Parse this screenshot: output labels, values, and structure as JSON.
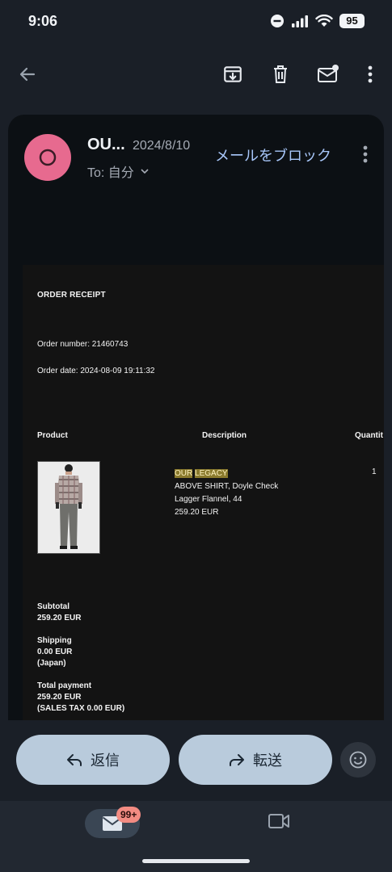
{
  "status_bar": {
    "time": "9:06",
    "battery": "95"
  },
  "toolbar": {
    "back_icon": "arrow-left-icon",
    "archive_icon": "archive-icon",
    "delete_icon": "trash-icon",
    "unread_icon": "mark-unread-icon",
    "more_icon": "more-vert-icon"
  },
  "email": {
    "avatar_letter": "O",
    "avatar_color": "#e76a8f",
    "sender": "OU...",
    "date": "2024/8/10",
    "to": "To: 自分",
    "block_link": "メールをブロック"
  },
  "receipt": {
    "title": "ORDER RECEIPT",
    "order_number": "Order number: 21460743",
    "order_date": "Order date: 2024-08-09 19:11:32",
    "headers": {
      "product": "Product",
      "description": "Description",
      "quantity": "Quantit"
    },
    "item": {
      "brand_1": "OUR",
      "brand_2": "LEGACY",
      "line2": "ABOVE SHIRT, Doyle Check",
      "line3": "Lagger Flannel, 44",
      "line4": "259.20 EUR",
      "quantity": "1"
    },
    "subtotal": {
      "label": "Subtotal",
      "value": "259.20 EUR"
    },
    "shipping": {
      "label": "Shipping",
      "value": "0.00 EUR",
      "note": "(Japan)"
    },
    "total": {
      "label": "Total payment",
      "value": "259.20 EUR",
      "note": "(SALES TAX 0.00 EUR)"
    }
  },
  "actions": {
    "reply": "返信",
    "forward": "転送"
  },
  "bottom_nav": {
    "mail_badge": "99+"
  }
}
